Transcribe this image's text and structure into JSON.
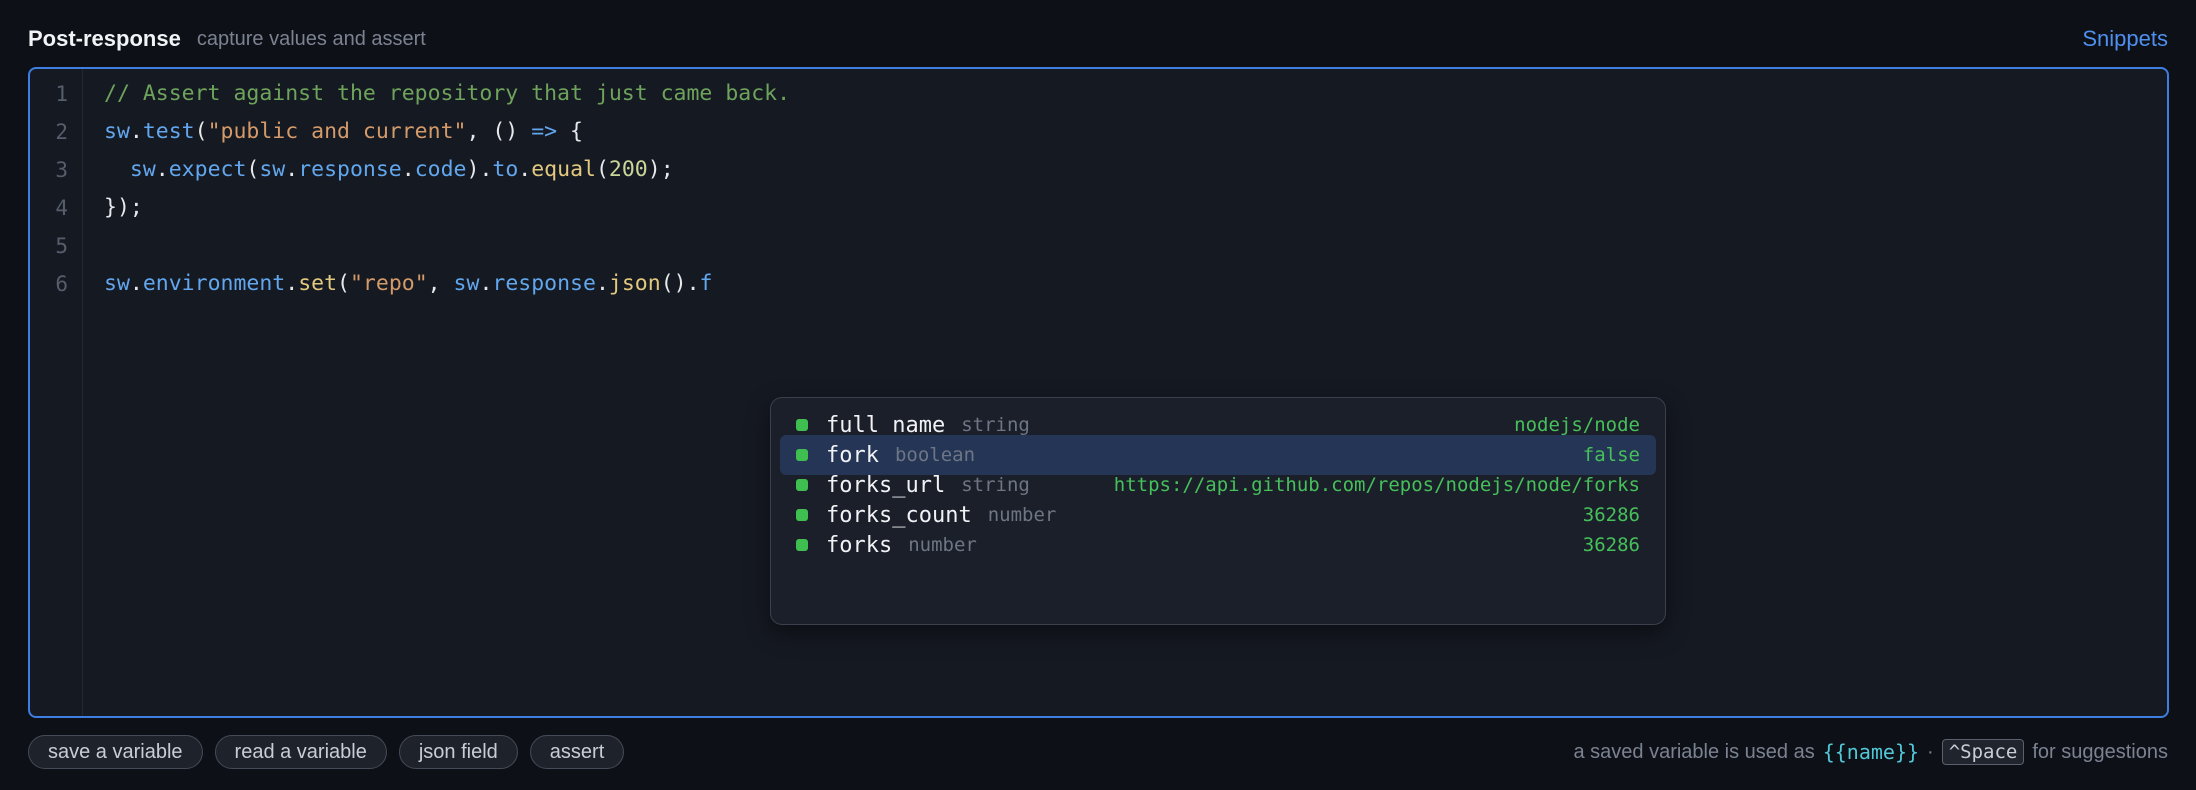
{
  "header": {
    "title": "Post-response",
    "subtitle": "capture values and assert",
    "snippets_label": "Snippets"
  },
  "editor": {
    "line_numbers": [
      "1",
      "2",
      "3",
      "4",
      "5",
      "6"
    ],
    "lines": [
      [
        {
          "t": "comment",
          "v": "// Assert against the repository that just came back."
        }
      ],
      [
        {
          "t": "id",
          "v": "sw"
        },
        {
          "t": "punc",
          "v": "."
        },
        {
          "t": "id",
          "v": "test"
        },
        {
          "t": "punc",
          "v": "("
        },
        {
          "t": "str",
          "v": "\"public and current\""
        },
        {
          "t": "punc",
          "v": ", () "
        },
        {
          "t": "op",
          "v": "=>"
        },
        {
          "t": "punc",
          "v": " {"
        }
      ],
      [
        {
          "t": "punc",
          "v": "  "
        },
        {
          "t": "id",
          "v": "sw"
        },
        {
          "t": "punc",
          "v": "."
        },
        {
          "t": "id",
          "v": "expect"
        },
        {
          "t": "punc",
          "v": "("
        },
        {
          "t": "id",
          "v": "sw"
        },
        {
          "t": "punc",
          "v": "."
        },
        {
          "t": "id",
          "v": "response"
        },
        {
          "t": "punc",
          "v": "."
        },
        {
          "t": "id",
          "v": "code"
        },
        {
          "t": "punc",
          "v": ")."
        },
        {
          "t": "id",
          "v": "to"
        },
        {
          "t": "punc",
          "v": "."
        },
        {
          "t": "fn",
          "v": "equal"
        },
        {
          "t": "punc",
          "v": "("
        },
        {
          "t": "num",
          "v": "200"
        },
        {
          "t": "punc",
          "v": ");"
        }
      ],
      [
        {
          "t": "punc",
          "v": "});"
        }
      ],
      [],
      [
        {
          "t": "id",
          "v": "sw"
        },
        {
          "t": "punc",
          "v": "."
        },
        {
          "t": "id",
          "v": "environment"
        },
        {
          "t": "punc",
          "v": "."
        },
        {
          "t": "fn",
          "v": "set"
        },
        {
          "t": "punc",
          "v": "("
        },
        {
          "t": "str",
          "v": "\"repo\""
        },
        {
          "t": "punc",
          "v": ", "
        },
        {
          "t": "id",
          "v": "sw"
        },
        {
          "t": "punc",
          "v": "."
        },
        {
          "t": "id",
          "v": "response"
        },
        {
          "t": "punc",
          "v": "."
        },
        {
          "t": "fn",
          "v": "json"
        },
        {
          "t": "punc",
          "v": "()."
        },
        {
          "t": "id",
          "v": "f"
        }
      ]
    ]
  },
  "autocomplete": {
    "selected_index": 1,
    "items": [
      {
        "name": "full_name",
        "type": "string",
        "value": "nodejs/node"
      },
      {
        "name": "fork",
        "type": "boolean",
        "value": "false"
      },
      {
        "name": "forks_url",
        "type": "string",
        "value": "https://api.github.com/repos/nodejs/node/forks"
      },
      {
        "name": "forks_count",
        "type": "number",
        "value": "36286"
      },
      {
        "name": "forks",
        "type": "number",
        "value": "36286"
      }
    ]
  },
  "footer": {
    "chips": [
      "save a variable",
      "read a variable",
      "json field",
      "assert"
    ],
    "hint_prefix": "a saved variable is used as",
    "hint_code": "{{name}}",
    "hint_sep": "·",
    "hint_key": "^Space",
    "hint_suffix": "for suggestions"
  },
  "colors": {
    "accent": "#3d7ee0",
    "selection": "#243556",
    "dot": "#3fbf4f",
    "value": "#46c05a"
  }
}
